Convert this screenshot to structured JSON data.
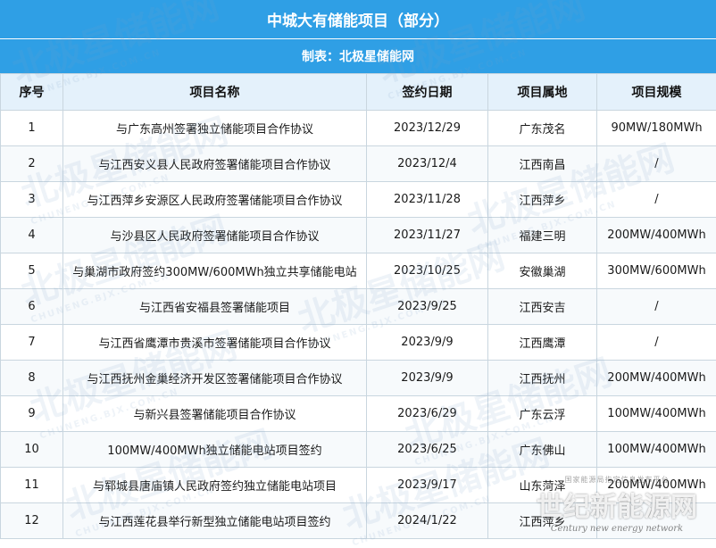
{
  "title": "中城大有储能项目（部分）",
  "subtitle": "制表：北极星储能网",
  "columns": [
    "序号",
    "项目名称",
    "签约日期",
    "项目属地",
    "项目规模"
  ],
  "rows": [
    [
      "1",
      "与广东高州签署独立储能项目合作协议",
      "2023/12/29",
      "广东茂名",
      "90MW/180MWh"
    ],
    [
      "2",
      "与江西安义县人民政府签署储能项目合作协议",
      "2023/12/4",
      "江西南昌",
      "/"
    ],
    [
      "3",
      "与江西萍乡安源区人民政府签署储能项目合作协议",
      "2023/11/28",
      "江西萍乡",
      "/"
    ],
    [
      "4",
      "与沙县区人民政府签署储能项目合作协议",
      "2023/11/27",
      "福建三明",
      "200MW/400MWh"
    ],
    [
      "5",
      "与巢湖市政府签约300MW/600MWh独立共享储能电站",
      "2023/10/25",
      "安徽巢湖",
      "300MW/600MWh"
    ],
    [
      "6",
      "与江西省安福县签署储能项目",
      "2023/9/25",
      "江西安吉",
      "/"
    ],
    [
      "7",
      "与江西省鹰潭市贵溪市签署储能项目合作协议",
      "2023/9/9",
      "江西鹰潭",
      "/"
    ],
    [
      "8",
      "与江西抚州金巢经济开发区签署储能项目合作协议",
      "2023/9/9",
      "江西抚州",
      "200MW/400MWh"
    ],
    [
      "9",
      "与新兴县签署储能项目合作协议",
      "2023/6/29",
      "广东云浮",
      "100MW/400MWh"
    ],
    [
      "10",
      "100MW/400MWh独立储能电站项目签约",
      "2023/6/25",
      "广东佛山",
      "100MW/400MWh"
    ],
    [
      "11",
      "与郓城县唐庙镇人民政府签约独立储能电站项目",
      "2023/9/17",
      "山东菏泽",
      "200MW/400MWh"
    ],
    [
      "12",
      "与江西莲花县举行新型独立储能电站项目签约",
      "2024/1/22",
      "江西萍乡",
      ""
    ]
  ],
  "watermark": {
    "text": "北极星储能网",
    "url": "CHUNENG.BJX.COM.CN"
  },
  "corner_logo": {
    "top": "国家能源局指定信息发布平台",
    "big": "世纪新能源网",
    "small": "Century new energy network"
  },
  "colors": {
    "header_blue": "#2f9fe5",
    "column_header_bg": "#e4f1fb"
  }
}
